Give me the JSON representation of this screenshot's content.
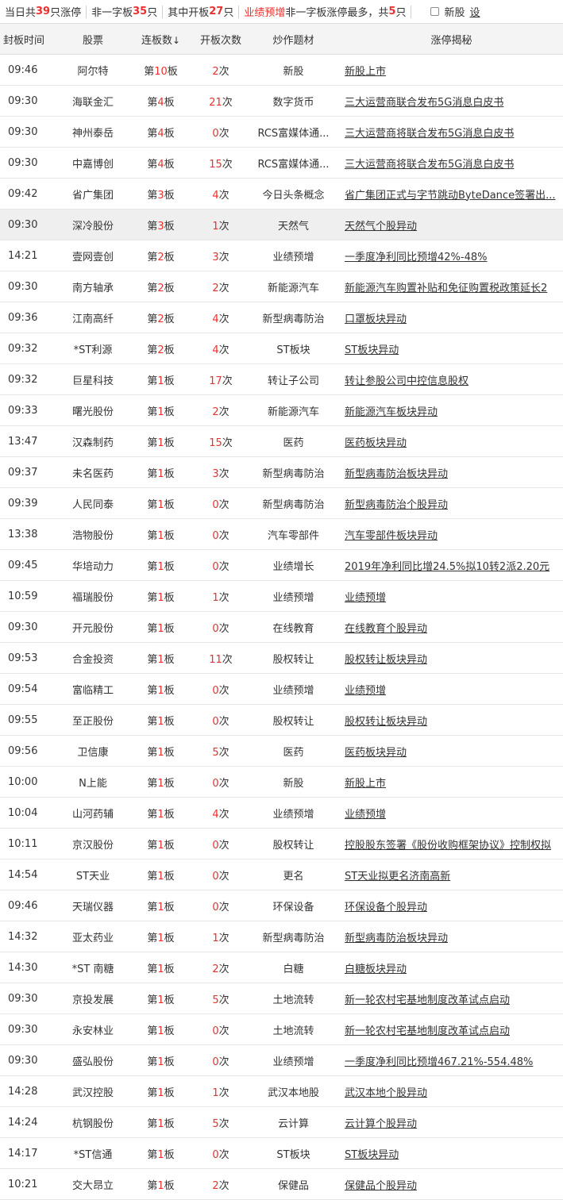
{
  "summary": {
    "total_prefix": "当日共",
    "total_count": "39",
    "total_suffix": "只涨停",
    "yizi_prefix": "非一字板",
    "yizi_count": "35",
    "yizi_suffix": "只",
    "open_prefix": "其中开板",
    "open_count": "27",
    "open_suffix": "只",
    "topic_name": "业绩预增",
    "topic_middle": "非一字板涨停最多，共",
    "topic_count": "5",
    "topic_suffix": "只",
    "new_stock_label": "新股",
    "settings_label": "设"
  },
  "columns": {
    "time": "封板时间",
    "stock": "股票",
    "boards": "连板数",
    "sort_icon": "↓",
    "opens": "开板次数",
    "theme": "炒作题材",
    "reason": "涨停揭秘"
  },
  "board_prefix": "第",
  "board_suffix": "板",
  "open_suffix": "次",
  "colors": {
    "accent": "#e8312f",
    "header_bg": "#f4f4f4",
    "highlight_row": "#efefef"
  },
  "rows": [
    {
      "time": "09:46",
      "stock": "阿尔特",
      "boards": "10",
      "opens": "2",
      "theme": "新股",
      "reason": "新股上市"
    },
    {
      "time": "09:30",
      "stock": "海联金汇",
      "boards": "4",
      "opens": "21",
      "theme": "数字货币",
      "reason": "三大运营商联合发布5G消息白皮书"
    },
    {
      "time": "09:30",
      "stock": "神州泰岳",
      "boards": "4",
      "opens": "0",
      "theme": "RCS富媒体通...",
      "reason": "三大运营商将联合发布5G消息白皮书"
    },
    {
      "time": "09:30",
      "stock": "中嘉博创",
      "boards": "4",
      "opens": "15",
      "theme": "RCS富媒体通...",
      "reason": "三大运营商将联合发布5G消息白皮书"
    },
    {
      "time": "09:42",
      "stock": "省广集团",
      "boards": "3",
      "opens": "4",
      "theme": "今日头条概念",
      "reason": "省广集团正式与字节跳动ByteDance签署出..."
    },
    {
      "time": "09:30",
      "stock": "深冷股份",
      "boards": "3",
      "opens": "1",
      "theme": "天然气",
      "reason": "天然气个股异动",
      "highlight": true
    },
    {
      "time": "14:21",
      "stock": "壹网壹创",
      "boards": "2",
      "opens": "3",
      "theme": "业绩预增",
      "reason": "一季度净利同比预增42%-48%"
    },
    {
      "time": "09:30",
      "stock": "南方轴承",
      "boards": "2",
      "opens": "2",
      "theme": "新能源汽车",
      "reason": "新能源汽车购置补贴和免征购置税政策延长2"
    },
    {
      "time": "09:36",
      "stock": "江南高纤",
      "boards": "2",
      "opens": "4",
      "theme": "新型病毒防治",
      "reason": "口罩板块异动"
    },
    {
      "time": "09:32",
      "stock": "*ST利源",
      "boards": "2",
      "opens": "4",
      "theme": "ST板块",
      "reason": "ST板块异动"
    },
    {
      "time": "09:32",
      "stock": "巨星科技",
      "boards": "1",
      "opens": "17",
      "theme": "转让子公司",
      "reason": "转让参股公司中控信息股权"
    },
    {
      "time": "09:33",
      "stock": "曙光股份",
      "boards": "1",
      "opens": "2",
      "theme": "新能源汽车",
      "reason": "新能源汽车板块异动"
    },
    {
      "time": "13:47",
      "stock": "汉森制药",
      "boards": "1",
      "opens": "15",
      "theme": "医药",
      "reason": "医药板块异动"
    },
    {
      "time": "09:37",
      "stock": "未名医药",
      "boards": "1",
      "opens": "3",
      "theme": "新型病毒防治",
      "reason": "新型病毒防治板块异动"
    },
    {
      "time": "09:39",
      "stock": "人民同泰",
      "boards": "1",
      "opens": "0",
      "theme": "新型病毒防治",
      "reason": "新型病毒防治个股异动"
    },
    {
      "time": "13:38",
      "stock": "浩物股份",
      "boards": "1",
      "opens": "0",
      "theme": "汽车零部件",
      "reason": "汽车零部件板块异动"
    },
    {
      "time": "09:45",
      "stock": "华培动力",
      "boards": "1",
      "opens": "0",
      "theme": "业绩增长",
      "reason": "2019年净利同比增24.5%拟10转2派2.20元"
    },
    {
      "time": "10:59",
      "stock": "福瑞股份",
      "boards": "1",
      "opens": "1",
      "theme": "业绩预增",
      "reason": "业绩预增"
    },
    {
      "time": "09:30",
      "stock": "开元股份",
      "boards": "1",
      "opens": "0",
      "theme": "在线教育",
      "reason": "在线教育个股异动"
    },
    {
      "time": "09:53",
      "stock": "合金投资",
      "boards": "1",
      "opens": "11",
      "theme": "股权转让",
      "reason": "股权转让板块异动"
    },
    {
      "time": "09:54",
      "stock": "富临精工",
      "boards": "1",
      "opens": "0",
      "theme": "业绩预增",
      "reason": "业绩预增"
    },
    {
      "time": "09:55",
      "stock": "至正股份",
      "boards": "1",
      "opens": "0",
      "theme": "股权转让",
      "reason": "股权转让板块异动"
    },
    {
      "time": "09:56",
      "stock": "卫信康",
      "boards": "1",
      "opens": "5",
      "theme": "医药",
      "reason": "医药板块异动"
    },
    {
      "time": "10:00",
      "stock": "N上能",
      "boards": "1",
      "opens": "0",
      "theme": "新股",
      "reason": "新股上市"
    },
    {
      "time": "10:04",
      "stock": "山河药辅",
      "boards": "1",
      "opens": "4",
      "theme": "业绩预增",
      "reason": "业绩预增"
    },
    {
      "time": "10:11",
      "stock": "京汉股份",
      "boards": "1",
      "opens": "0",
      "theme": "股权转让",
      "reason": "控股股东签署《股份收购框架协议》控制权拟"
    },
    {
      "time": "14:54",
      "stock": "ST天业",
      "boards": "1",
      "opens": "0",
      "theme": "更名",
      "reason": "ST天业拟更名济南高新"
    },
    {
      "time": "09:46",
      "stock": "天瑞仪器",
      "boards": "1",
      "opens": "0",
      "theme": "环保设备",
      "reason": "环保设备个股异动"
    },
    {
      "time": "14:32",
      "stock": "亚太药业",
      "boards": "1",
      "opens": "1",
      "theme": "新型病毒防治",
      "reason": "新型病毒防治板块异动"
    },
    {
      "time": "14:30",
      "stock": "*ST 南糖",
      "boards": "1",
      "opens": "2",
      "theme": "白糖",
      "reason": "白糖板块异动"
    },
    {
      "time": "09:30",
      "stock": "京投发展",
      "boards": "1",
      "opens": "5",
      "theme": "土地流转",
      "reason": "新一轮农村宅基地制度改革试点启动"
    },
    {
      "time": "09:30",
      "stock": "永安林业",
      "boards": "1",
      "opens": "0",
      "theme": "土地流转",
      "reason": "新一轮农村宅基地制度改革试点启动"
    },
    {
      "time": "09:30",
      "stock": "盛弘股份",
      "boards": "1",
      "opens": "0",
      "theme": "业绩预增",
      "reason": "一季度净利同比预增467.21%-554.48%"
    },
    {
      "time": "14:28",
      "stock": "武汉控股",
      "boards": "1",
      "opens": "1",
      "theme": "武汉本地股",
      "reason": "武汉本地个股异动"
    },
    {
      "time": "14:24",
      "stock": "杭钢股份",
      "boards": "1",
      "opens": "5",
      "theme": "云计算",
      "reason": "云计算个股异动"
    },
    {
      "time": "14:17",
      "stock": "*ST信通",
      "boards": "1",
      "opens": "0",
      "theme": "ST板块",
      "reason": "ST板块异动"
    },
    {
      "time": "10:21",
      "stock": "交大昂立",
      "boards": "1",
      "opens": "2",
      "theme": "保健品",
      "reason": "保健品个股异动"
    }
  ]
}
